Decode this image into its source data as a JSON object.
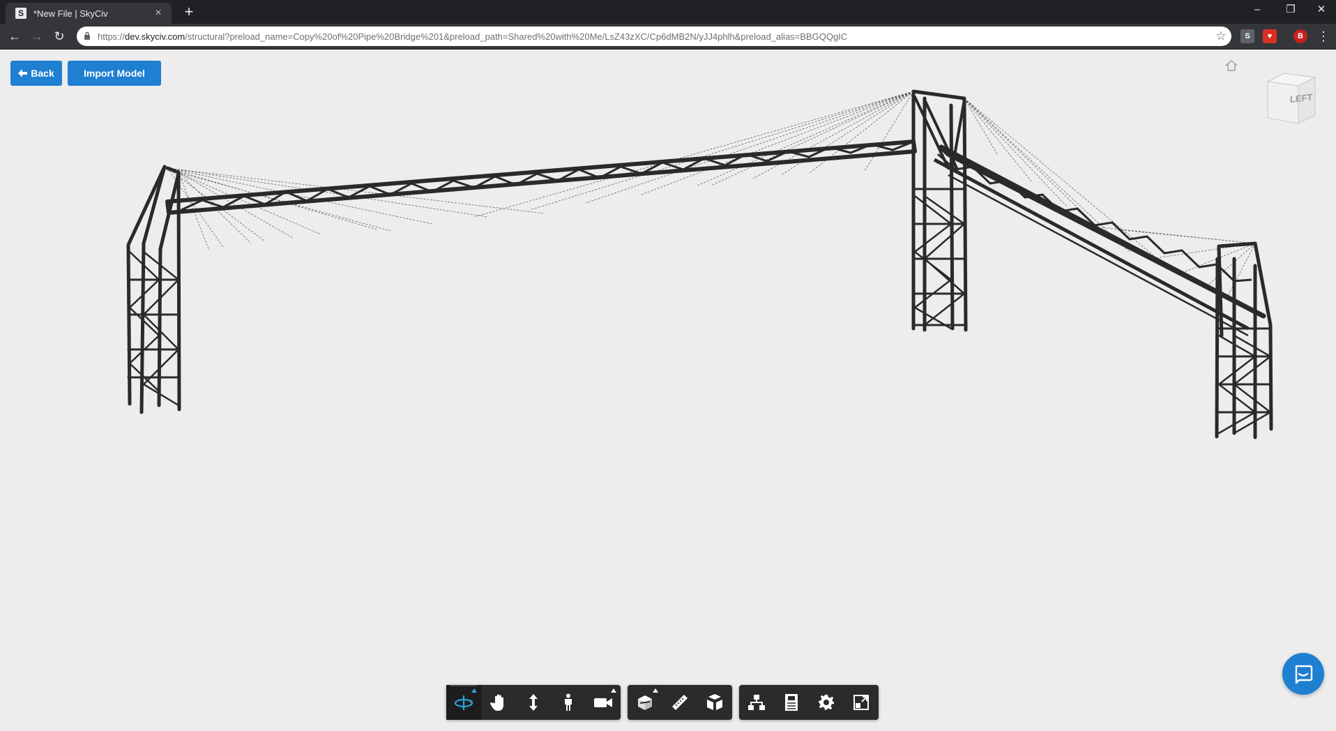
{
  "browser": {
    "tab": {
      "favicon": "S",
      "title": "*New File | SkyCiv"
    },
    "new_tab": "+",
    "window": {
      "minimize": "–",
      "restore": "❐",
      "close": "✕"
    },
    "nav": {
      "back": "←",
      "forward": "→",
      "reload": "↻"
    },
    "url": {
      "scheme": "https://",
      "host": "dev.skyciv.com",
      "path": "/structural?preload_name=Copy%20of%20Pipe%20Bridge%201&preload_path=Shared%20with%20Me/LsZ43zXC/Cp6dMB2N/yJJ4phlh&preload_alias=BBGQQgIC"
    },
    "bookmark": "☆",
    "extensions": [
      {
        "name": "skyciv-ext",
        "label": "S",
        "color": "#5f6368"
      },
      {
        "name": "shield-ext",
        "label": "♥",
        "color": "#d93025"
      },
      {
        "name": "profile-avatar",
        "label": "B",
        "color": "#c5221f"
      }
    ],
    "menu": "⋮"
  },
  "app": {
    "back_label": "Back",
    "import_label": "Import Model",
    "viewcube_label": "LEFT",
    "dock": [
      {
        "name": "orbit-tool",
        "icon": "orbit-icon",
        "active": true,
        "caret": true
      },
      {
        "name": "pan-tool",
        "icon": "hand-icon"
      },
      {
        "name": "zoom-tool",
        "icon": "vertical-arrows-icon"
      },
      {
        "name": "walk-tool",
        "icon": "person-icon"
      },
      {
        "name": "camera-tool",
        "icon": "camera-icon",
        "caret": true
      },
      {
        "name": "section-tool",
        "icon": "section-box-icon",
        "caret": true
      },
      {
        "name": "measure-tool",
        "icon": "ruler-icon"
      },
      {
        "name": "explode-tool",
        "icon": "explode-icon"
      },
      {
        "name": "model-browser",
        "icon": "hierarchy-icon"
      },
      {
        "name": "properties-tool",
        "icon": "properties-icon"
      },
      {
        "name": "settings-tool",
        "icon": "gear-icon"
      },
      {
        "name": "fullscreen-tool",
        "icon": "fullscreen-icon"
      }
    ],
    "colors": {
      "accent": "#1f7fd1",
      "member": "#2a2a2a",
      "cable": "#555555",
      "active_icon": "#29a3e0"
    }
  }
}
